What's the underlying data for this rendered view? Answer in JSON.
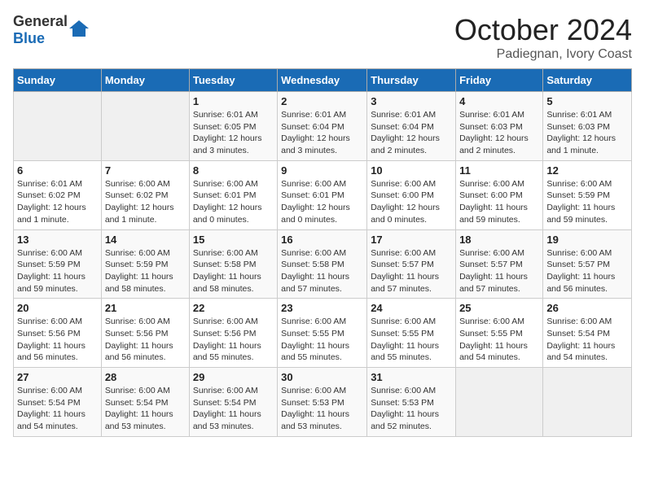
{
  "header": {
    "logo_general": "General",
    "logo_blue": "Blue",
    "month": "October 2024",
    "location": "Padiegnan, Ivory Coast"
  },
  "weekdays": [
    "Sunday",
    "Monday",
    "Tuesday",
    "Wednesday",
    "Thursday",
    "Friday",
    "Saturday"
  ],
  "weeks": [
    [
      {
        "day": "",
        "info": ""
      },
      {
        "day": "",
        "info": ""
      },
      {
        "day": "1",
        "info": "Sunrise: 6:01 AM\nSunset: 6:05 PM\nDaylight: 12 hours and 3 minutes."
      },
      {
        "day": "2",
        "info": "Sunrise: 6:01 AM\nSunset: 6:04 PM\nDaylight: 12 hours and 3 minutes."
      },
      {
        "day": "3",
        "info": "Sunrise: 6:01 AM\nSunset: 6:04 PM\nDaylight: 12 hours and 2 minutes."
      },
      {
        "day": "4",
        "info": "Sunrise: 6:01 AM\nSunset: 6:03 PM\nDaylight: 12 hours and 2 minutes."
      },
      {
        "day": "5",
        "info": "Sunrise: 6:01 AM\nSunset: 6:03 PM\nDaylight: 12 hours and 1 minute."
      }
    ],
    [
      {
        "day": "6",
        "info": "Sunrise: 6:01 AM\nSunset: 6:02 PM\nDaylight: 12 hours and 1 minute."
      },
      {
        "day": "7",
        "info": "Sunrise: 6:00 AM\nSunset: 6:02 PM\nDaylight: 12 hours and 1 minute."
      },
      {
        "day": "8",
        "info": "Sunrise: 6:00 AM\nSunset: 6:01 PM\nDaylight: 12 hours and 0 minutes."
      },
      {
        "day": "9",
        "info": "Sunrise: 6:00 AM\nSunset: 6:01 PM\nDaylight: 12 hours and 0 minutes."
      },
      {
        "day": "10",
        "info": "Sunrise: 6:00 AM\nSunset: 6:00 PM\nDaylight: 12 hours and 0 minutes."
      },
      {
        "day": "11",
        "info": "Sunrise: 6:00 AM\nSunset: 6:00 PM\nDaylight: 11 hours and 59 minutes."
      },
      {
        "day": "12",
        "info": "Sunrise: 6:00 AM\nSunset: 5:59 PM\nDaylight: 11 hours and 59 minutes."
      }
    ],
    [
      {
        "day": "13",
        "info": "Sunrise: 6:00 AM\nSunset: 5:59 PM\nDaylight: 11 hours and 59 minutes."
      },
      {
        "day": "14",
        "info": "Sunrise: 6:00 AM\nSunset: 5:59 PM\nDaylight: 11 hours and 58 minutes."
      },
      {
        "day": "15",
        "info": "Sunrise: 6:00 AM\nSunset: 5:58 PM\nDaylight: 11 hours and 58 minutes."
      },
      {
        "day": "16",
        "info": "Sunrise: 6:00 AM\nSunset: 5:58 PM\nDaylight: 11 hours and 57 minutes."
      },
      {
        "day": "17",
        "info": "Sunrise: 6:00 AM\nSunset: 5:57 PM\nDaylight: 11 hours and 57 minutes."
      },
      {
        "day": "18",
        "info": "Sunrise: 6:00 AM\nSunset: 5:57 PM\nDaylight: 11 hours and 57 minutes."
      },
      {
        "day": "19",
        "info": "Sunrise: 6:00 AM\nSunset: 5:57 PM\nDaylight: 11 hours and 56 minutes."
      }
    ],
    [
      {
        "day": "20",
        "info": "Sunrise: 6:00 AM\nSunset: 5:56 PM\nDaylight: 11 hours and 56 minutes."
      },
      {
        "day": "21",
        "info": "Sunrise: 6:00 AM\nSunset: 5:56 PM\nDaylight: 11 hours and 56 minutes."
      },
      {
        "day": "22",
        "info": "Sunrise: 6:00 AM\nSunset: 5:56 PM\nDaylight: 11 hours and 55 minutes."
      },
      {
        "day": "23",
        "info": "Sunrise: 6:00 AM\nSunset: 5:55 PM\nDaylight: 11 hours and 55 minutes."
      },
      {
        "day": "24",
        "info": "Sunrise: 6:00 AM\nSunset: 5:55 PM\nDaylight: 11 hours and 55 minutes."
      },
      {
        "day": "25",
        "info": "Sunrise: 6:00 AM\nSunset: 5:55 PM\nDaylight: 11 hours and 54 minutes."
      },
      {
        "day": "26",
        "info": "Sunrise: 6:00 AM\nSunset: 5:54 PM\nDaylight: 11 hours and 54 minutes."
      }
    ],
    [
      {
        "day": "27",
        "info": "Sunrise: 6:00 AM\nSunset: 5:54 PM\nDaylight: 11 hours and 54 minutes."
      },
      {
        "day": "28",
        "info": "Sunrise: 6:00 AM\nSunset: 5:54 PM\nDaylight: 11 hours and 53 minutes."
      },
      {
        "day": "29",
        "info": "Sunrise: 6:00 AM\nSunset: 5:54 PM\nDaylight: 11 hours and 53 minutes."
      },
      {
        "day": "30",
        "info": "Sunrise: 6:00 AM\nSunset: 5:53 PM\nDaylight: 11 hours and 53 minutes."
      },
      {
        "day": "31",
        "info": "Sunrise: 6:00 AM\nSunset: 5:53 PM\nDaylight: 11 hours and 52 minutes."
      },
      {
        "day": "",
        "info": ""
      },
      {
        "day": "",
        "info": ""
      }
    ]
  ]
}
